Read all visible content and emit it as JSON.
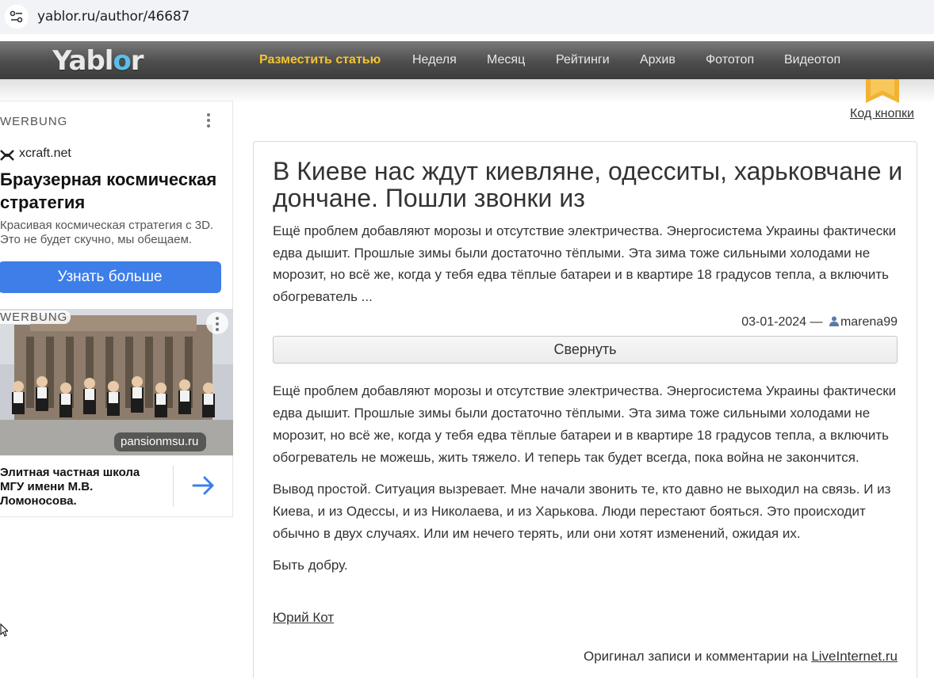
{
  "browser": {
    "url": "yablor.ru/author/46687"
  },
  "nav": {
    "logo_prefix": "Yabl",
    "logo_o": "o",
    "logo_suffix": "r",
    "items": [
      {
        "label": "Разместить статью",
        "primary": true
      },
      {
        "label": "Неделя"
      },
      {
        "label": "Месяц"
      },
      {
        "label": "Рейтинги"
      },
      {
        "label": "Архив"
      },
      {
        "label": "Фототоп"
      },
      {
        "label": "Видеотоп"
      }
    ]
  },
  "code_button": {
    "label": "Код кнопки"
  },
  "ads": {
    "ad1": {
      "label": "WERBUNG",
      "domain": "xcraft.net",
      "title": "Браузерная космическая стратегия",
      "description": "Красивая космическая стратегия с 3D. Это не будет скучно, мы обещаем.",
      "cta": "Узнать больше"
    },
    "ad2": {
      "label": "WERBUNG",
      "domain": "pansionmsu.ru",
      "title": "Элитная частная школа МГУ имени М.В. Ломоносова."
    }
  },
  "article": {
    "title": "В Киеве нас ждут киевляне, одесситы, харьковчане и дончане. Пошли звонки из",
    "lead": "Ещё проблем добавляют морозы и отсутствие электричества. Энергосистема Украины фактически едва дышит. Прошлые зимы были достаточно тёплыми. Эта зима тоже сильными холодами не морозит, но всё же, когда у тебя едва тёплые батареи и в квартире 18 градусов тепла, а включить обогреватель ...",
    "date": "03-01-2024",
    "date_sep": "—",
    "author_user": "marena99",
    "collapse_label": "Свернуть",
    "paragraphs": [
      "Ещё проблем добавляют морозы и отсутствие электричества. Энергосистема Украины фактически едва дышит. Прошлые зимы были достаточно тёплыми. Эта зима тоже сильными холодами не морозит, но всё же, когда у тебя едва тёплые батареи и в квартире 18 градусов тепла, а включить обогреватель не можешь, жить тяжело. И теперь так будет всегда, пока война не закончится.",
      "Вывод простой. Ситуация вызревает. Мне начали звонить те, кто давно не выходил на связь. И из Киева, и из Одессы, и из Николаева, и из Харькова. Люди перестают бояться. Это происходит обычно в двух случаях. Или им нечего терять, или они хотят изменений, ожидая их.",
      "Быть добру."
    ],
    "signature": "Юрий Кот",
    "source_prefix": "Оригинал записи и комментарии на",
    "source_link": "LiveInternet.ru"
  }
}
